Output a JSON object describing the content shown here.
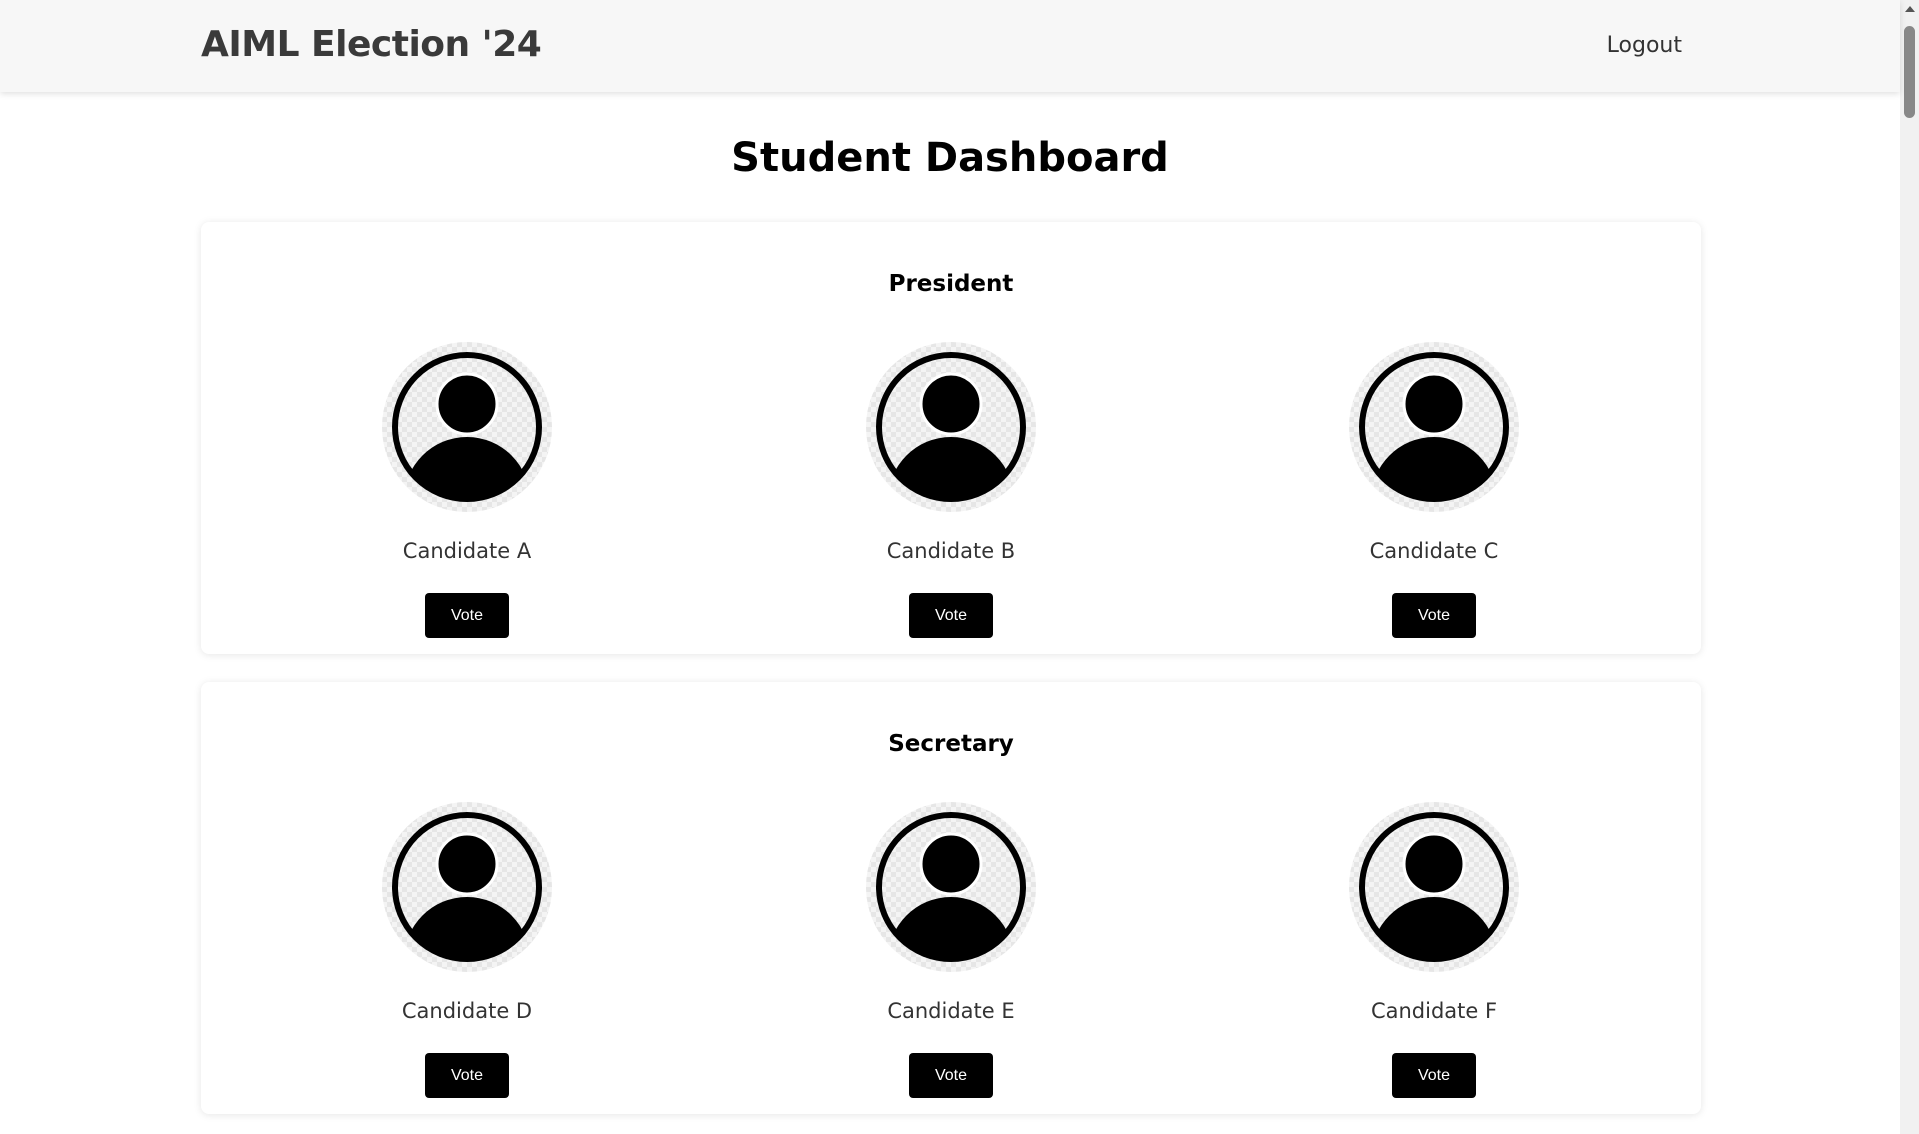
{
  "header": {
    "brand": "AIML Election '24",
    "logout_label": "Logout"
  },
  "main": {
    "title": "Student Dashboard",
    "sections": [
      {
        "title": "President",
        "candidates": [
          {
            "name": "Candidate A",
            "vote_label": "Vote",
            "icon": "user-avatar-icon"
          },
          {
            "name": "Candidate B",
            "vote_label": "Vote",
            "icon": "user-avatar-icon"
          },
          {
            "name": "Candidate C",
            "vote_label": "Vote",
            "icon": "user-avatar-icon"
          }
        ]
      },
      {
        "title": "Secretary",
        "candidates": [
          {
            "name": "Candidate D",
            "vote_label": "Vote",
            "icon": "user-avatar-icon"
          },
          {
            "name": "Candidate E",
            "vote_label": "Vote",
            "icon": "user-avatar-icon"
          },
          {
            "name": "Candidate F",
            "vote_label": "Vote",
            "icon": "user-avatar-icon"
          }
        ]
      }
    ]
  },
  "colors": {
    "navbar_bg": "#f7f7f7",
    "button_bg": "#000000",
    "button_text": "#ffffff",
    "page_bg": "#ffffff"
  }
}
